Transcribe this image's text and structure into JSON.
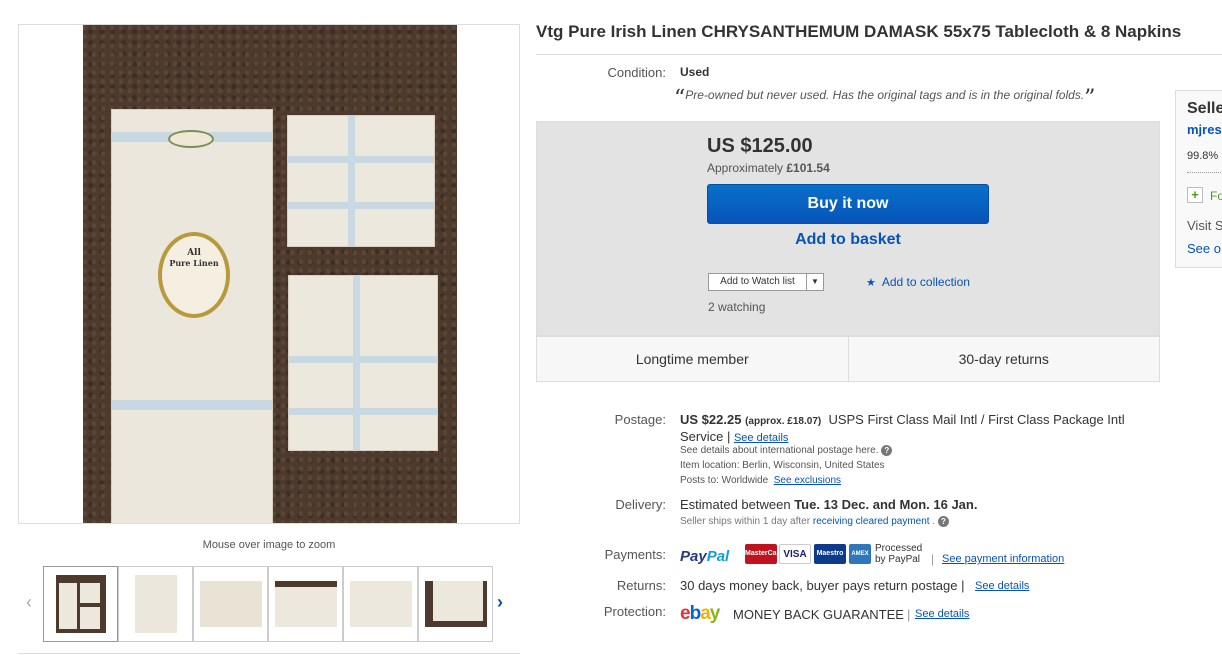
{
  "gallery": {
    "zoom_hint": "Mouse over image to zoom",
    "prev_icon": "chevron-left-icon",
    "next_icon": "chevron-right-icon",
    "label_text": [
      "All",
      "Pure Linen"
    ]
  },
  "listing": {
    "title": "Vtg Pure Irish Linen CHRYSANTHEMUM DAMASK 55x75 Tablecloth & 8 Napkins"
  },
  "condition": {
    "label": "Condition:",
    "value": "Used",
    "note": "Pre-owned but never used. Has the original tags and is in the original folds.",
    "open_quote": "“",
    "close_quote": "”"
  },
  "buy": {
    "price": "US $125.00",
    "approx_prefix": "Approximately",
    "approx_value": "£101.54",
    "buy_now": "Buy it now",
    "add_basket": "Add to basket",
    "watch_label": "Add to Watch list",
    "watch_dropdown": "▼",
    "add_collection": "Add to collection",
    "watching": "2 watching"
  },
  "features": [
    "Longtime member",
    "30-day returns"
  ],
  "postage": {
    "label": "Postage:",
    "price": "US $22.25",
    "approx": "(approx. £18.07)",
    "service_line1": "USPS First Class Mail Intl / First Class Package Intl",
    "service_line2": "Service |",
    "see_details": "See details",
    "intl_note": "See details about international postage here.",
    "location": "Item location:  Berlin, Wisconsin, United States",
    "posts_to_label": "Posts to:  Worldwide",
    "see_exclusions": "See exclusions"
  },
  "delivery": {
    "label": "Delivery:",
    "prefix": "Estimated between",
    "range": "Tue. 13 Dec. and Mon. 16 Jan.",
    "ships_prefix": "Seller ships within 1 day after",
    "ships_link": "receiving cleared payment",
    "ships_suffix": "."
  },
  "payments": {
    "label": "Payments:",
    "paypal_a": "Pay",
    "paypal_b": "Pal",
    "cards": [
      "MasterCard",
      "VISA",
      "Maestro",
      "AMEX"
    ],
    "processed_line1": "Processed",
    "processed_line2": "by PayPal",
    "see_info": "See payment information"
  },
  "returns": {
    "label": "Returns:",
    "text": "30 days money back, buyer pays return postage |",
    "see_details": "See details"
  },
  "protection": {
    "label": "Protection:",
    "logo": [
      "e",
      "b",
      "a",
      "y"
    ],
    "text": "MONEY BACK GUARANTEE",
    "see_details": "See details"
  },
  "seller": {
    "title": "Seller",
    "name": "mjres",
    "feedback": "99.8%",
    "follow_icon": "plus-icon",
    "follow": "Fo",
    "visit": "Visit S",
    "see_other": "See o"
  },
  "colors": {
    "accent": "#0654ba",
    "buy_box": "#e3e3e3"
  }
}
